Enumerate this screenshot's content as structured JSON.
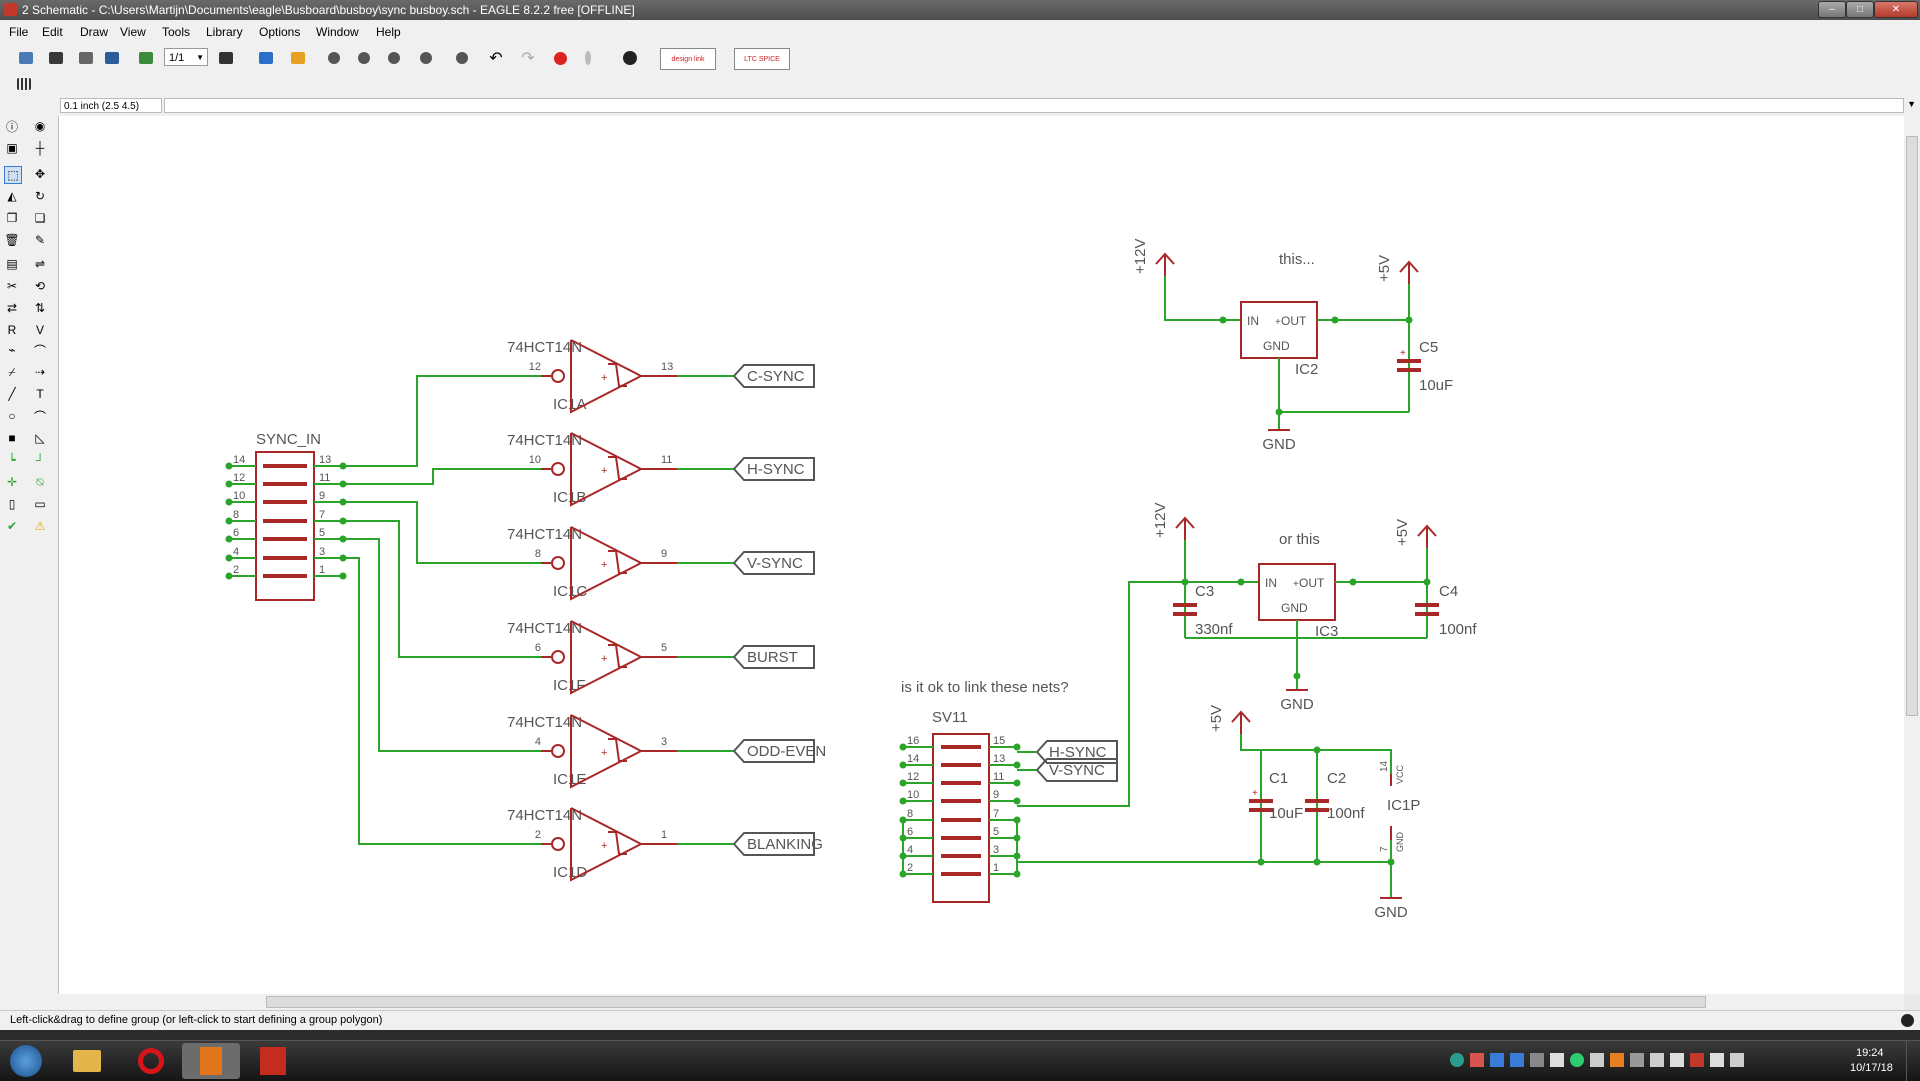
{
  "window": {
    "title": "2 Schematic - C:\\Users\\Martijn\\Documents\\eagle\\Busboard\\busboy\\sync busboy.sch - EAGLE 8.2.2 free [OFFLINE]"
  },
  "menu": [
    "File",
    "Edit",
    "Draw",
    "View",
    "Tools",
    "Library",
    "Options",
    "Window",
    "Help"
  ],
  "toolbar": {
    "sheet_select": "1/1",
    "design_link_label": "design link",
    "ltspice_label": "LTC SPICE"
  },
  "coord": "0.1 inch (2.5 4.5)",
  "status": "Left-click&drag to define group (or left-click to start defining a group polygon)",
  "clock": {
    "time": "19:24",
    "date": "10/17/18"
  },
  "colors": {
    "part": "#a82828",
    "net": "#2aa52a",
    "label": "#555555",
    "junction": "#2aa52a"
  },
  "left_tools": [
    "info-icon",
    "eye-icon",
    "layer-icon",
    "mark-icon",
    "select-icon",
    "move-icon",
    "mirror-icon",
    "rotate-icon",
    "copy-icon",
    "paste-icon",
    "delete-icon",
    "wrench-icon",
    "add-icon",
    "replace-icon",
    "split-icon",
    "invoke-icon",
    "gate-swap-icon",
    "pin-swap-icon",
    "name-icon",
    "value-icon",
    "smash-icon",
    "miter-icon",
    "split-line-icon",
    "optimize-icon",
    "line-icon",
    "text-icon",
    "circle-icon",
    "arc-icon",
    "rect-icon",
    "polygon-icon",
    "net-icon",
    "bus-icon",
    "junction-icon",
    "label-icon",
    "attribute-icon",
    "dimension-icon",
    "erc-icon",
    "errors-icon"
  ],
  "schematic": {
    "sync_in": {
      "name": "SYNC_IN",
      "pins_left": [
        "14",
        "12",
        "10",
        "8",
        "6",
        "4",
        "2"
      ],
      "pins_right": [
        "13",
        "11",
        "9",
        "7",
        "5",
        "3",
        "1"
      ]
    },
    "inverters": [
      {
        "value": "74HCT14N",
        "name": "IC1A",
        "in_pin": "12",
        "out_pin": "13",
        "label": "C-SYNC"
      },
      {
        "value": "74HCT14N",
        "name": "IC1B",
        "in_pin": "10",
        "out_pin": "11",
        "label": "H-SYNC"
      },
      {
        "value": "74HCT14N",
        "name": "IC1C",
        "in_pin": "8",
        "out_pin": "9",
        "label": "V-SYNC"
      },
      {
        "value": "74HCT14N",
        "name": "IC1F",
        "in_pin": "6",
        "out_pin": "5",
        "label": "BURST"
      },
      {
        "value": "74HCT14N",
        "name": "IC1E",
        "in_pin": "4",
        "out_pin": "3",
        "label": "ODD-EVEN"
      },
      {
        "value": "74HCT14N",
        "name": "IC1D",
        "in_pin": "2",
        "out_pin": "1",
        "label": "BLANKING"
      }
    ],
    "reg1": {
      "note": "this...",
      "in": "IN",
      "out": "OUT",
      "gnd": "GND",
      "name": "IC2",
      "supply_in": "+12V",
      "supply_out": "+5V",
      "cap_name": "C5",
      "cap_value": "10uF",
      "ground": "GND"
    },
    "reg2": {
      "note": "or this",
      "in": "IN",
      "out": "OUT",
      "gnd": "GND",
      "name": "IC3",
      "supply_in": "+12V",
      "supply_out": "+5V",
      "cap_in_name": "C3",
      "cap_in_value": "330nf",
      "cap_out_name": "C4",
      "cap_out_value": "100nf",
      "ground": "GND"
    },
    "question": "is it ok to link these nets?",
    "sv11": {
      "name": "SV11",
      "pins_left": [
        "16",
        "14",
        "12",
        "10",
        "8",
        "6",
        "4",
        "2"
      ],
      "pins_right": [
        "15",
        "13",
        "11",
        "9",
        "7",
        "5",
        "3",
        "1"
      ],
      "label_a": "H-SYNC",
      "label_b": "V-SYNC"
    },
    "power": {
      "supply": "+5V",
      "c1_name": "C1",
      "c1_value": "10uF",
      "c2_name": "C2",
      "c2_value": "100nf",
      "ic_name": "IC1P",
      "vcc": "VCC",
      "gnd_pin": "GND",
      "pin_vcc": "14",
      "pin_gnd": "7",
      "ground": "GND"
    }
  }
}
